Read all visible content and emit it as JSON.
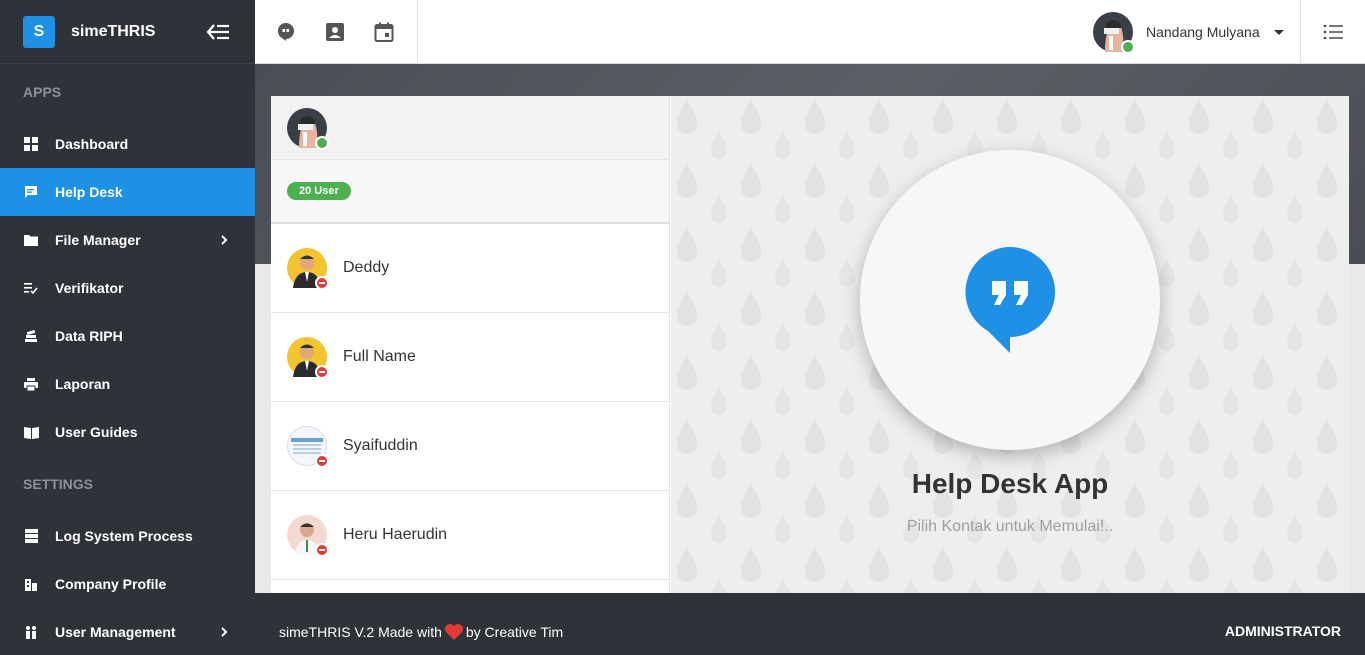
{
  "app": {
    "logo_letter": "S",
    "name": "simeTHRIS"
  },
  "sidebar": {
    "sections": [
      {
        "title": "APPS"
      },
      {
        "title": "SETTINGS"
      }
    ],
    "apps": [
      {
        "label": "Dashboard",
        "icon": "dashboard-icon"
      },
      {
        "label": "Help Desk",
        "icon": "chat-icon",
        "active": true
      },
      {
        "label": "File Manager",
        "icon": "folder-icon",
        "has_submenu": true
      },
      {
        "label": "Verifikator",
        "icon": "checklist-icon"
      },
      {
        "label": "Data RIPH",
        "icon": "stack-icon"
      },
      {
        "label": "Laporan",
        "icon": "printer-icon"
      },
      {
        "label": "User Guides",
        "icon": "book-icon"
      }
    ],
    "settings": [
      {
        "label": "Log System Process",
        "icon": "server-icon"
      },
      {
        "label": "Company Profile",
        "icon": "building-icon"
      },
      {
        "label": "User Management",
        "icon": "users-icon",
        "has_submenu": true
      }
    ]
  },
  "topbar": {
    "icons": [
      "hangouts-icon",
      "contact-card-icon",
      "calendar-icon"
    ],
    "user_name": "Nandang Mulyana"
  },
  "contacts": {
    "count_badge": "20 User",
    "items": [
      {
        "name": "Deddy"
      },
      {
        "name": "Full Name"
      },
      {
        "name": "Syaifuddin"
      },
      {
        "name": "Heru Haerudin"
      }
    ]
  },
  "pane": {
    "title": "Help Desk App",
    "subtitle": "Pilih Kontak untuk Memulai!.."
  },
  "footer": {
    "left_prefix": "simeTHRIS V.2 Made with",
    "left_suffix": "by Creative Tim",
    "right": "ADMINISTRATOR"
  },
  "colors": {
    "accent": "#1e90e6",
    "sidebar": "#2f3238",
    "online": "#4caf50",
    "offline": "#e53935"
  }
}
